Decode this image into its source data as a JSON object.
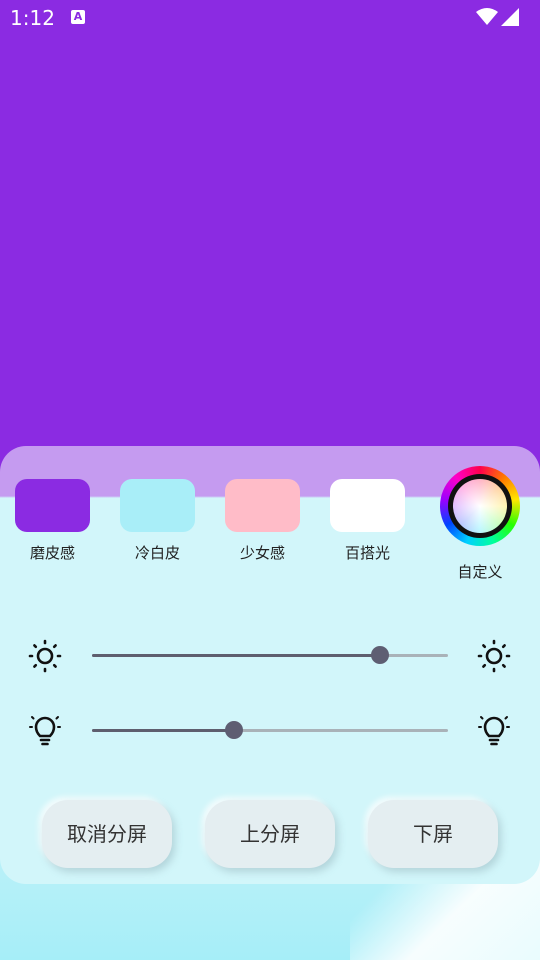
{
  "status_bar": {
    "time": "1:12",
    "notification_icon": "A"
  },
  "presets": [
    {
      "label": "磨皮感",
      "color": "#8B2BE2"
    },
    {
      "label": "冷白皮",
      "color": "#A9EEF8"
    },
    {
      "label": "少女感",
      "color": "#FFBCC8"
    },
    {
      "label": "百搭光",
      "color": "#FFFFFF"
    }
  ],
  "custom": {
    "label": "自定义",
    "icon": "color-wheel-icon"
  },
  "sliders": [
    {
      "name": "brightness",
      "icon": "sun-icon",
      "value": 0.81
    },
    {
      "name": "color-temperature",
      "icon": "bulb-icon",
      "value": 0.4
    }
  ],
  "buttons": {
    "cancel_split": "取消分屏",
    "top_split": "上分屏",
    "bottom_split": "下屏"
  },
  "colors": {
    "preview": "#8B2BE2",
    "panel_top": "#C59BF0",
    "panel_body": "#D2F6FA"
  }
}
